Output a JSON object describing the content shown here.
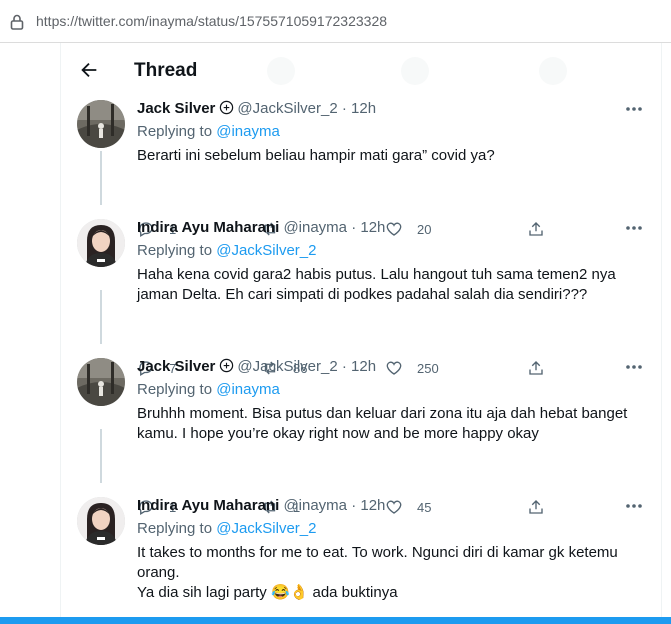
{
  "browser": {
    "url": "https://twitter.com/inayma/status/1575571059172323328"
  },
  "header": {
    "title": "Thread",
    "back_icon": "arrow-left-icon"
  },
  "tweets": [
    {
      "name": "Jack Silver",
      "handle": "@JackSilver_2",
      "time": "12h",
      "replying_label": "Replying to",
      "replying_to": "@inayma",
      "lines": [
        "Berarti ini sebelum beliau hampir mati gara” covid ya?"
      ],
      "replies": "1",
      "retweets": "",
      "likes": "20"
    },
    {
      "name": "Indira Ayu Maharani",
      "handle": "@inayma",
      "time": "12h",
      "replying_label": "Replying to",
      "replying_to": "@JackSilver_2",
      "lines": [
        "Haha kena covid gara2 habis putus. Lalu hangout tuh sama temen2 nya",
        "jaman Delta. Eh cari simpati di podkes padahal salah dia sendiri???"
      ],
      "replies": "7",
      "retweets": "86",
      "likes": "250"
    },
    {
      "name": "Jack Silver",
      "handle": "@JackSilver_2",
      "time": "12h",
      "replying_label": "Replying to",
      "replying_to": "@inayma",
      "lines": [
        "Bruhhh moment. Bisa putus dan keluar  dari zona itu aja dah hebat banget",
        "kamu. I hope you’re okay right now and be more happy okay"
      ],
      "replies": "1",
      "retweets": "1",
      "likes": "45"
    },
    {
      "name": "Indira Ayu Maharani",
      "handle": "@inayma",
      "time": "12h",
      "replying_label": "Replying to",
      "replying_to": "@JackSilver_2",
      "lines": [
        "It takes to months for me to eat. To work. Ngunci diri di kamar gk ketemu",
        "orang.",
        "Ya dia sih lagi party 😂👌 ada buktinya"
      ]
    }
  ],
  "colors": {
    "accent": "#1d9bf0",
    "text": "#0f1419",
    "secondary": "#536471",
    "divider": "#eff3f4"
  }
}
